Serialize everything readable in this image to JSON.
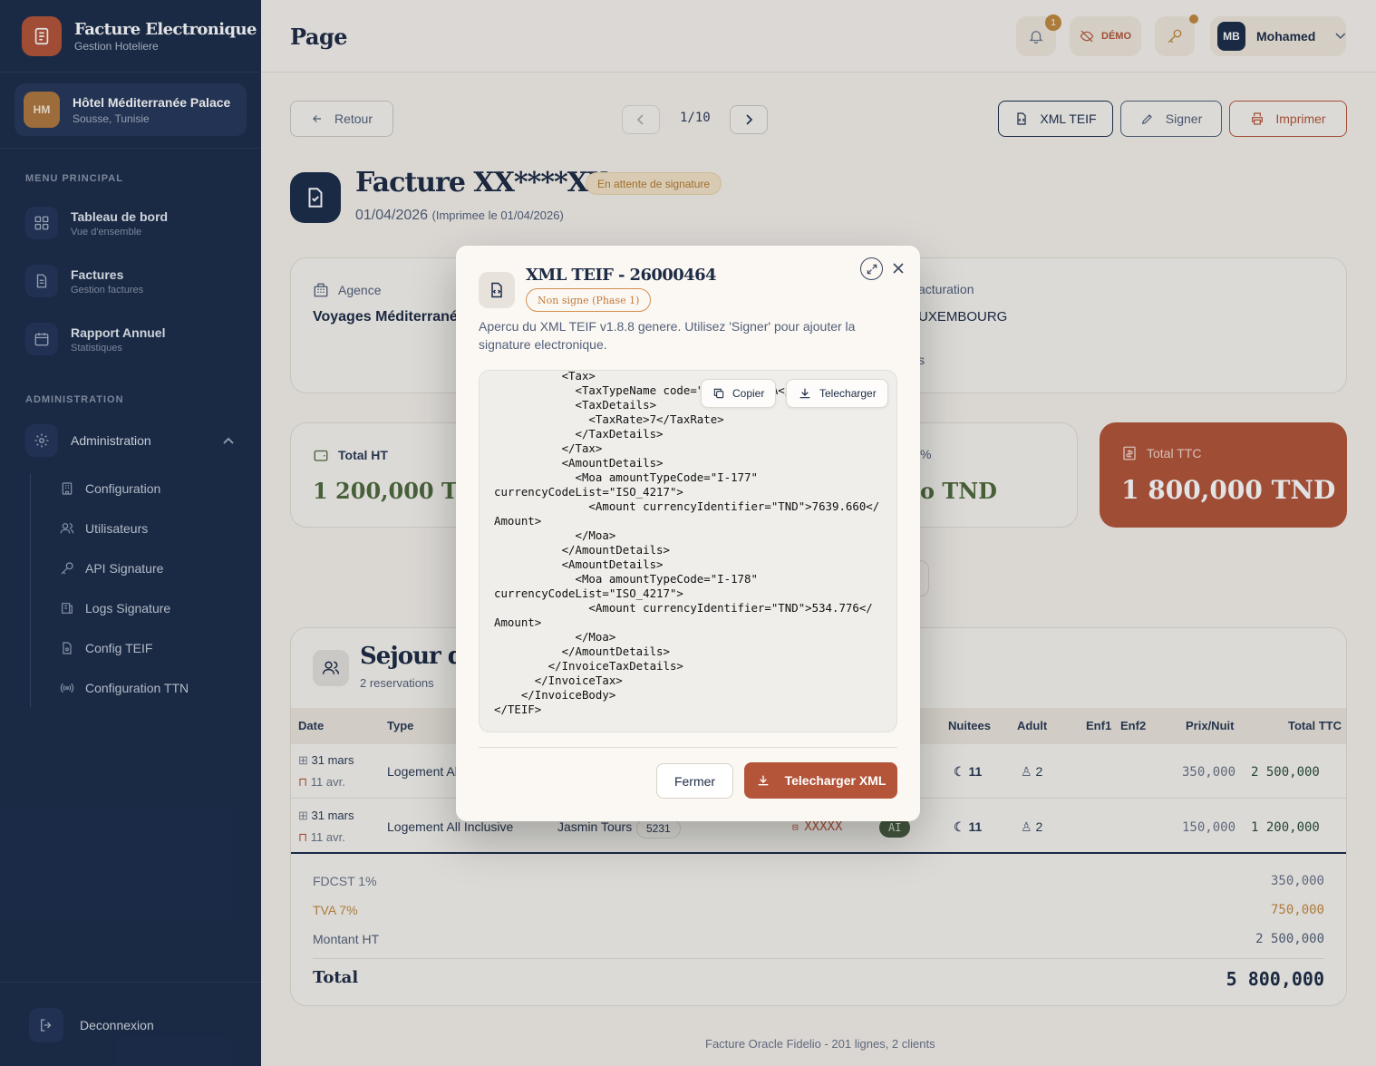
{
  "brand": {
    "title": "Facture Electronique",
    "subtitle": "Gestion Hoteliere"
  },
  "hotel": {
    "initials": "HM",
    "name": "Hôtel Méditerranée Palace",
    "location": "Sousse, Tunisie"
  },
  "sidebar": {
    "menu_section": "MENU PRINCIPAL",
    "items": [
      {
        "label": "Tableau de bord",
        "sub": "Vue d'ensemble"
      },
      {
        "label": "Factures",
        "sub": "Gestion factures"
      },
      {
        "label": "Rapport Annuel",
        "sub": "Statistiques"
      }
    ],
    "admin_section": "ADMINISTRATION",
    "admin_label": "Administration",
    "admin_items": [
      "Configuration",
      "Utilisateurs",
      "API Signature",
      "Logs Signature",
      "Config TEIF",
      "Configuration TTN"
    ],
    "logout": "Deconnexion"
  },
  "header": {
    "title": "Page",
    "notif_count": "1",
    "demo_label": "DÉMO",
    "user_initials": "MB",
    "user_name": "Mohamed"
  },
  "toolbar": {
    "back": "Retour",
    "pagination": "1/10",
    "xml": "XML TEIF",
    "sign": "Signer",
    "print": "Imprimer"
  },
  "invoice": {
    "title": "Facture XX****XX",
    "status": "En attente de signature",
    "date": "01/04/2026",
    "printed": "(Imprimee le 01/04/2026)"
  },
  "info": {
    "agency_label": "Agence",
    "agency_value": "Voyages Méditerrané",
    "billing_label": "acturation",
    "billing_value": "UXEMBOURG",
    "billing_extra": "s"
  },
  "totals_cards": {
    "ht_label": "Total HT",
    "ht_value": "1 200,000 TNI",
    "mid_label": "%",
    "mid_value": "o TND",
    "ttc_label": "Total TTC",
    "ttc_value": "1 800,000 TND"
  },
  "section": {
    "title": "Sejour de",
    "subtitle": "2 reservations"
  },
  "table": {
    "headers": [
      "Date",
      "Type",
      "Nuitees",
      "Adult",
      "Enf1",
      "Enf2",
      "Prix/Nuit",
      "Total TTC"
    ],
    "rows": [
      {
        "date_in": "31 mars",
        "date_out": "11 avr.",
        "type": "Logement Al",
        "agency": "",
        "code": "",
        "voucher": "",
        "board": "",
        "nights": "11",
        "adults": "2",
        "price": "350,000",
        "total": "2 500,000"
      },
      {
        "date_in": "31 mars",
        "date_out": "11 avr.",
        "type": "Logement All Inclusive",
        "agency": "Jasmin Tours",
        "code": "5231",
        "voucher": "XXXXX",
        "board": "AI",
        "nights": "11",
        "adults": "2",
        "price": "150,000",
        "total": "1 200,000"
      }
    ]
  },
  "summary": [
    {
      "label": "FDCST 1%",
      "value": "350,000"
    },
    {
      "label": "TVA 7%",
      "value": "750,000"
    },
    {
      "label": "Montant HT",
      "value": "2 500,000"
    }
  ],
  "summary_total": {
    "label": "Total",
    "value": "5 800,000"
  },
  "footer": "Facture Oracle Fidelio - 201 lignes, 2 clients",
  "modal": {
    "title": "XML TEIF - 26000464",
    "badge": "Non signe (Phase 1)",
    "description": "Apercu du XML TEIF v1.8.8 genere. Utilisez 'Signer' pour ajouter la signature electronique.",
    "copy": "Copier",
    "download": "Telecharger",
    "xml": "          <Tax>\n            <TaxTypeName code=\"I-1602\">TVA</TaxTypeName>\n            <TaxDetails>\n              <TaxRate>7</TaxRate>\n            </TaxDetails>\n          </Tax>\n          <AmountDetails>\n            <Moa amountTypeCode=\"I-177\"\ncurrencyCodeList=\"ISO_4217\">\n              <Amount currencyIdentifier=\"TND\">7639.660</\nAmount>\n            </Moa>\n          </AmountDetails>\n          <AmountDetails>\n            <Moa amountTypeCode=\"I-178\"\ncurrencyCodeList=\"ISO_4217\">\n              <Amount currencyIdentifier=\"TND\">534.776</\nAmount>\n            </Moa>\n          </AmountDetails>\n        </InvoiceTaxDetails>\n      </InvoiceTax>\n    </InvoiceBody>\n</TEIF>",
    "close": "Fermer",
    "download_xml": "Telecharger XML"
  },
  "colors": {
    "navy": "#1c2d4b",
    "accent": "#b4553a",
    "green": "#4f6a3d",
    "gold": "#c3893f"
  }
}
